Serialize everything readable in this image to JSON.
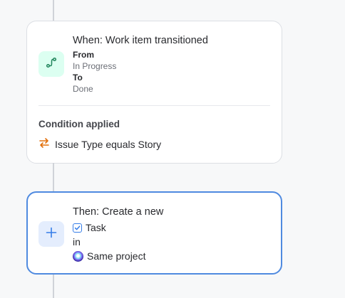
{
  "trigger": {
    "title": "When: Work item transitioned",
    "icon": "transition-icon",
    "from_label": "From",
    "from_value": "In Progress",
    "to_label": "To",
    "to_value": "Done",
    "condition_heading": "Condition applied",
    "condition_icon": "swap-arrows-icon",
    "condition_text": "Issue Type equals Story",
    "icon_color": "#1f845a",
    "condition_icon_color": "#e2700b"
  },
  "action": {
    "title": "Then: Create a new",
    "icon": "plus-icon",
    "work_type": "Task",
    "work_type_icon": "task-checkbox-icon",
    "connector_word": "in",
    "project": "Same project",
    "project_icon": "project-avatar-icon",
    "accent_color": "#4f8ae0"
  }
}
